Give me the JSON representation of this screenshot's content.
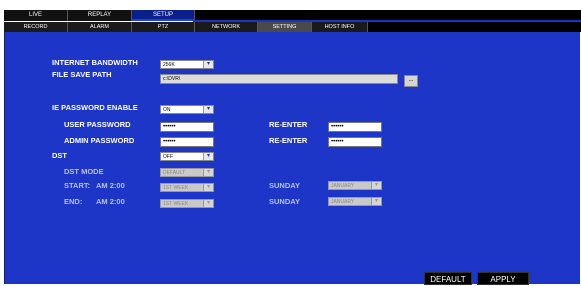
{
  "top_tabs": [
    {
      "label": "LIVE",
      "active": false
    },
    {
      "label": "REPLAY",
      "active": false
    },
    {
      "label": "SETUP",
      "active": true
    }
  ],
  "sub_tabs": [
    {
      "label": "RECORD",
      "active": false
    },
    {
      "label": "ALARM",
      "active": false
    },
    {
      "label": "PTZ",
      "active": false
    },
    {
      "label": "NETWORK",
      "active": false
    },
    {
      "label": "SETTING",
      "active": true
    },
    {
      "label": "HOST INFO",
      "active": false
    }
  ],
  "settings": {
    "internet_bandwidth": {
      "label": "INTERNET BANDWIDTH",
      "value": "256K"
    },
    "file_save_path": {
      "label": "FILE SAVE PATH",
      "value": "c:\\DVR\\",
      "browse_label": "..."
    },
    "ie_password_enable": {
      "label": "IE PASSWORD ENABLE",
      "value": "ON"
    },
    "user_password": {
      "label": "USER PASSWORD",
      "value": "••••••",
      "reenter_label": "RE-ENTER",
      "reenter_value": "••••••"
    },
    "admin_password": {
      "label": "ADMIN PASSWORD",
      "value": "••••••",
      "reenter_label": "RE-ENTER",
      "reenter_value": "••••••"
    },
    "dst": {
      "label": "DST",
      "value": "OFF"
    },
    "dst_mode": {
      "label": "DST MODE",
      "value": "DEFAULT"
    },
    "start": {
      "label": "START:",
      "time": "AM 2:00",
      "week": "1ST WEEK",
      "day": "SUNDAY",
      "month": "JANUARY"
    },
    "end": {
      "label": "END:",
      "time": "AM 2:00",
      "week": "1ST WEEK",
      "day": "SUNDAY",
      "month": "JANUARY"
    }
  },
  "buttons": {
    "default": "DEFAULT",
    "apply": "APPLY"
  },
  "colors": {
    "panel": "#1d36c8",
    "active_tab": "#0b1f8a",
    "bar": "#000000"
  }
}
